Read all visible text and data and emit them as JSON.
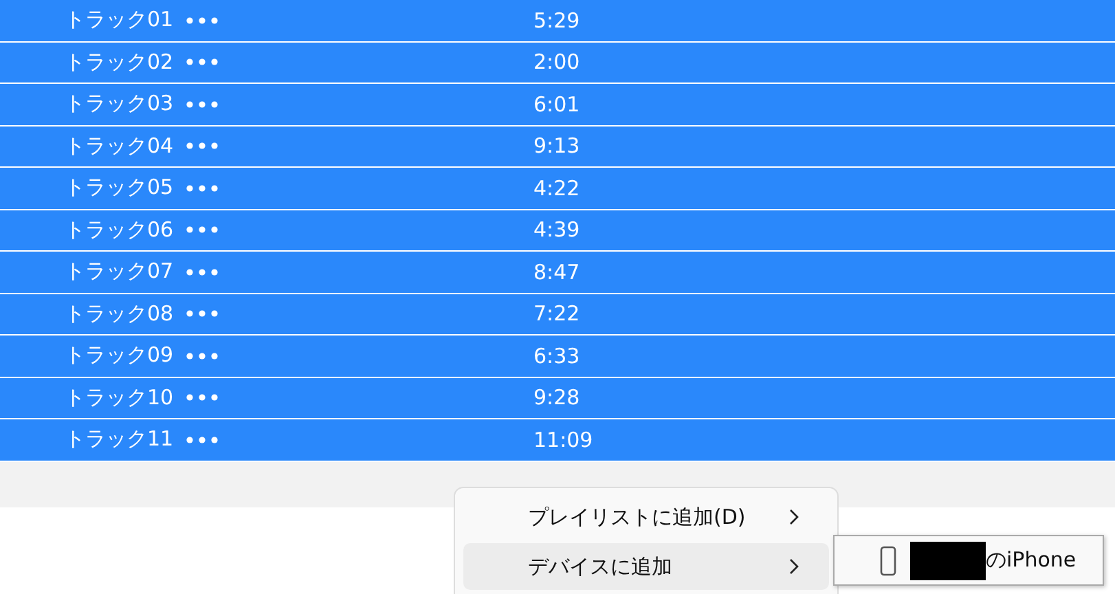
{
  "tracks": [
    {
      "title": "トラック01",
      "duration": "5:29",
      "selected": true
    },
    {
      "title": "トラック02",
      "duration": "2:00",
      "selected": true
    },
    {
      "title": "トラック03",
      "duration": "6:01",
      "selected": true
    },
    {
      "title": "トラック04",
      "duration": "9:13",
      "selected": true
    },
    {
      "title": "トラック05",
      "duration": "4:22",
      "selected": true
    },
    {
      "title": "トラック06",
      "duration": "4:39",
      "selected": true
    },
    {
      "title": "トラック07",
      "duration": "8:47",
      "selected": true
    },
    {
      "title": "トラック08",
      "duration": "7:22",
      "selected": true
    },
    {
      "title": "トラック09",
      "duration": "6:33",
      "selected": true
    },
    {
      "title": "トラック10",
      "duration": "9:28",
      "selected": true
    },
    {
      "title": "トラック11",
      "duration": "11:09",
      "selected": true
    }
  ],
  "context_menu": {
    "items": [
      {
        "label": "プレイリストに追加(D)",
        "selected": false
      },
      {
        "label": "デバイスに追加",
        "selected": true
      }
    ]
  },
  "submenu": {
    "items": [
      {
        "label": "のiPhone",
        "redacted": true
      }
    ]
  }
}
